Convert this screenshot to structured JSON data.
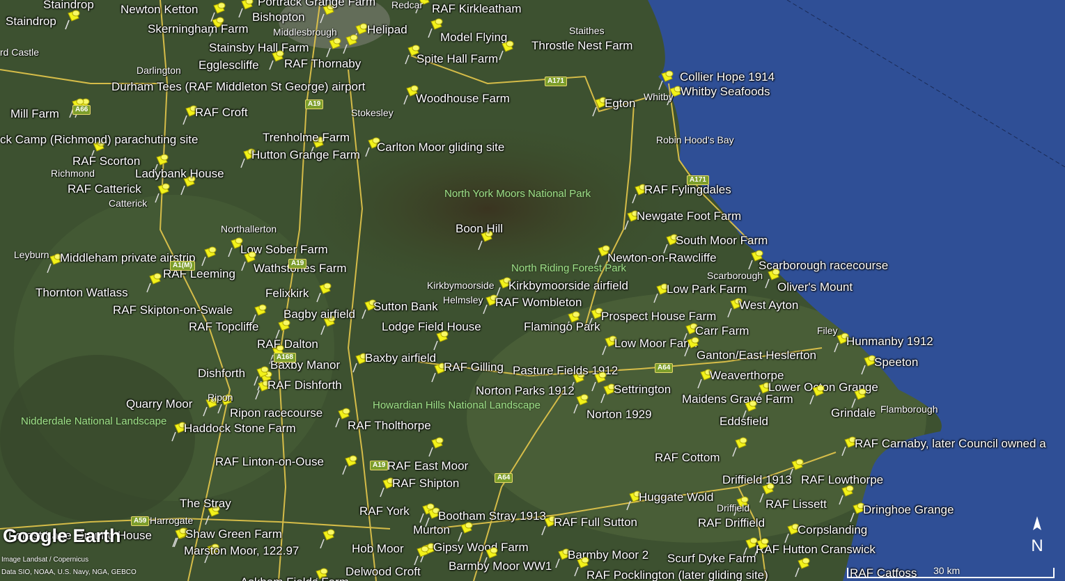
{
  "map": {
    "logo": "Google Earth",
    "credit_imagery": "Image Landsat / Copernicus",
    "credit_data": "Data SIO, NOAA, U.S. Navy, NGA, GEBCO",
    "scale_label": "30 km",
    "compass_label": "N",
    "colors": {
      "sea": "#2f4f96",
      "land": "#3b4f2c",
      "road": "#e6c84b",
      "pin": "#f2f21a"
    }
  },
  "placemarks": [
    {
      "id": "staindrop-a",
      "label": "Staindrop"
    },
    {
      "id": "staindrop-b",
      "label": "Staindrop"
    },
    {
      "id": "newton-ketton",
      "label": "Newton Ketton"
    },
    {
      "id": "bishopton",
      "label": "Bishopton"
    },
    {
      "id": "portrack",
      "label": "Portrack Grange Farm"
    },
    {
      "id": "raf-kirkleatham",
      "label": "RAF Kirkleatham"
    },
    {
      "id": "skerningham",
      "label": "Skerningham Farm"
    },
    {
      "id": "helipad",
      "label": "Helipad"
    },
    {
      "id": "model-flying",
      "label": "Model Flying"
    },
    {
      "id": "stainsby",
      "label": "Stainsby Hall Farm"
    },
    {
      "id": "throstle",
      "label": "Throstle Nest Farm"
    },
    {
      "id": "spite-hall",
      "label": "Spite Hall Farm"
    },
    {
      "id": "egglescliffe",
      "label": "Egglescliffe"
    },
    {
      "id": "raf-thornaby",
      "label": "RAF Thornaby"
    },
    {
      "id": "collier-hope",
      "label": "Collier Hope 1914"
    },
    {
      "id": "durham-tees",
      "label": "Durham Tees (RAF Middleton St George) airport"
    },
    {
      "id": "whitby-seafoods",
      "label": "Whitby Seafoods"
    },
    {
      "id": "woodhouse",
      "label": "Woodhouse Farm"
    },
    {
      "id": "egton",
      "label": "Egton"
    },
    {
      "id": "mill-farm",
      "label": "Mill Farm"
    },
    {
      "id": "raf-croft",
      "label": "RAF Croft"
    },
    {
      "id": "trenholme",
      "label": "Trenholme Farm"
    },
    {
      "id": "richmond-camp",
      "label": "ck Camp (Richmond) parachuting site"
    },
    {
      "id": "carlton-moor",
      "label": "Carlton Moor gliding site"
    },
    {
      "id": "hutton-grange",
      "label": "Hutton Grange Farm"
    },
    {
      "id": "raf-scorton",
      "label": "RAF Scorton"
    },
    {
      "id": "ladybank",
      "label": "Ladybank House"
    },
    {
      "id": "raf-catterick",
      "label": "RAF Catterick"
    },
    {
      "id": "raf-fylingdales",
      "label": "RAF Fylingdales"
    },
    {
      "id": "newgate-foot",
      "label": "Newgate Foot Farm"
    },
    {
      "id": "boon-hill",
      "label": "Boon Hill"
    },
    {
      "id": "south-moor",
      "label": "South Moor Farm"
    },
    {
      "id": "low-sober",
      "label": "Low Sober Farm"
    },
    {
      "id": "middleham",
      "label": "Middleham private airstrip"
    },
    {
      "id": "newton-rawcliffe",
      "label": "Newton-on-Rawcliffe"
    },
    {
      "id": "scarborough-race",
      "label": "Scarborough racecourse"
    },
    {
      "id": "wathstones",
      "label": "Wathstones Farm"
    },
    {
      "id": "raf-leeming",
      "label": "RAF Leeming"
    },
    {
      "id": "kirkbymoorside-af",
      "label": "Kirkbymoorside airfield"
    },
    {
      "id": "olivers-mount",
      "label": "Oliver's Mount"
    },
    {
      "id": "low-park",
      "label": "Low Park Farm"
    },
    {
      "id": "thornton-watlass",
      "label": "Thornton Watlass"
    },
    {
      "id": "felixkirk",
      "label": "Felixkirk"
    },
    {
      "id": "raf-wombleton",
      "label": "RAF Wombleton"
    },
    {
      "id": "west-ayton",
      "label": "West Ayton"
    },
    {
      "id": "sutton-bank",
      "label": "Sutton Bank"
    },
    {
      "id": "raf-skipton",
      "label": "RAF Skipton-on-Swale"
    },
    {
      "id": "bagby",
      "label": "Bagby airfield"
    },
    {
      "id": "prospect-house",
      "label": "Prospect House Farm"
    },
    {
      "id": "raf-topcliffe",
      "label": "RAF Topcliffe"
    },
    {
      "id": "lodge-field",
      "label": "Lodge Field House"
    },
    {
      "id": "flamingo-park",
      "label": "Flamingo Park"
    },
    {
      "id": "carr-farm",
      "label": "Carr Farm"
    },
    {
      "id": "hunmanby",
      "label": "Hunmanby 1912"
    },
    {
      "id": "raf-dalton",
      "label": "RAF Dalton"
    },
    {
      "id": "low-moor",
      "label": "Low Moor Farm"
    },
    {
      "id": "ganton",
      "label": "Ganton/East Heslerton"
    },
    {
      "id": "baxby-af",
      "label": "Baxby airfield"
    },
    {
      "id": "speeton",
      "label": "Speeton"
    },
    {
      "id": "baxby-manor",
      "label": "Baxby Manor"
    },
    {
      "id": "raf-gilling",
      "label": "RAF Gilling"
    },
    {
      "id": "pasture-fields",
      "label": "Pasture Fields 1912"
    },
    {
      "id": "dishforth",
      "label": "Dishforth"
    },
    {
      "id": "weaverthorpe",
      "label": "Weaverthorpe"
    },
    {
      "id": "raf-dishforth",
      "label": "RAF Dishforth"
    },
    {
      "id": "norton-parks",
      "label": "Norton Parks 1912"
    },
    {
      "id": "settrington",
      "label": "Settrington"
    },
    {
      "id": "lower-octon",
      "label": "Lower Octon Grange"
    },
    {
      "id": "maidens-grave",
      "label": "Maidens Grave Farm"
    },
    {
      "id": "quarry-moor",
      "label": "Quarry Moor"
    },
    {
      "id": "ripon-race",
      "label": "Ripon racecourse"
    },
    {
      "id": "grindale",
      "label": "Grindale"
    },
    {
      "id": "norton-1929",
      "label": "Norton 1929"
    },
    {
      "id": "eddsfield",
      "label": "Eddsfield"
    },
    {
      "id": "raf-tholthorpe",
      "label": "RAF Tholthorpe"
    },
    {
      "id": "haddock-stone",
      "label": "Haddock Stone Farm"
    },
    {
      "id": "raf-carnaby",
      "label": "RAF Carnaby, later Council owned a"
    },
    {
      "id": "raf-linton",
      "label": "RAF Linton-on-Ouse"
    },
    {
      "id": "raf-east-moor",
      "label": "RAF East Moor"
    },
    {
      "id": "raf-cottom",
      "label": "RAF Cottom"
    },
    {
      "id": "driffield-1913",
      "label": "Driffield 1913"
    },
    {
      "id": "raf-lowthorpe",
      "label": "RAF Lowthorpe"
    },
    {
      "id": "raf-shipton",
      "label": "RAF Shipton"
    },
    {
      "id": "huggate-wold",
      "label": "Huggate Wold"
    },
    {
      "id": "the-stray",
      "label": "The Stray"
    },
    {
      "id": "raf-lissett",
      "label": "RAF Lissett"
    },
    {
      "id": "raf-york",
      "label": "RAF York"
    },
    {
      "id": "dringhoe",
      "label": "Dringhoe Grange"
    },
    {
      "id": "bootham-stray",
      "label": "Bootham Stray 1913"
    },
    {
      "id": "raf-full-sutton",
      "label": "RAF Full Sutton"
    },
    {
      "id": "raf-driffield",
      "label": "RAF Driffield"
    },
    {
      "id": "murton",
      "label": "Murton"
    },
    {
      "id": "corpslanding",
      "label": "Corpslanding"
    },
    {
      "id": "forest-house",
      "label": "Forest Lane Ground House"
    },
    {
      "id": "shaw-green",
      "label": "Shaw Green Farm"
    },
    {
      "id": "gipsy-wood",
      "label": "Gipsy Wood Farm"
    },
    {
      "id": "hob-moor",
      "label": "Hob Moor"
    },
    {
      "id": "raf-hutton-cranswick",
      "label": "RAF Hutton Cranswick"
    },
    {
      "id": "marston-moor",
      "label": "Marston Moor, 122.97"
    },
    {
      "id": "barmby-moor-2",
      "label": "Barmby Moor 2"
    },
    {
      "id": "scurf-dyke",
      "label": "Scurf Dyke Farm"
    },
    {
      "id": "barmby-moor-ww1",
      "label": "Barmby Moor WW1"
    },
    {
      "id": "delwood-croft",
      "label": "Delwood Croft"
    },
    {
      "id": "raf-catfoss",
      "label": "RAF Catfoss"
    },
    {
      "id": "raf-pocklington",
      "label": "RAF Pocklington (later gliding site)"
    },
    {
      "id": "askham-fields",
      "label": "Askham Fields Farm"
    }
  ],
  "places": [
    {
      "id": "redcar",
      "label": "Redcar"
    },
    {
      "id": "middlesbrough",
      "label": "Middlesbrough"
    },
    {
      "id": "staithes",
      "label": "Staithes"
    },
    {
      "id": "castle",
      "label": "rd Castle"
    },
    {
      "id": "darlington",
      "label": "Darlington"
    },
    {
      "id": "whitby",
      "label": "Whitby"
    },
    {
      "id": "stokesley",
      "label": "Stokesley"
    },
    {
      "id": "robin-hoods-bay",
      "label": "Robin Hood's Bay"
    },
    {
      "id": "richmond",
      "label": "Richmond"
    },
    {
      "id": "catterick",
      "label": "Catterick"
    },
    {
      "id": "northallerton",
      "label": "Northallerton"
    },
    {
      "id": "leyburn",
      "label": "Leyburn"
    },
    {
      "id": "scarborough",
      "label": "Scarborough"
    },
    {
      "id": "kirkbymoorside",
      "label": "Kirkbymoorside"
    },
    {
      "id": "helmsley",
      "label": "Helmsley"
    },
    {
      "id": "filey",
      "label": "Filey"
    },
    {
      "id": "ripon",
      "label": "Ripon"
    },
    {
      "id": "flamborough",
      "label": "Flamborough"
    },
    {
      "id": "harrogate",
      "label": "Harrogate"
    },
    {
      "id": "driffield",
      "label": "Driffield"
    }
  ],
  "parks": [
    {
      "id": "nym",
      "label": "North York Moors National Park"
    },
    {
      "id": "nrfp",
      "label": "North Riding Forest Park"
    },
    {
      "id": "howardian",
      "label": "Howardian Hills National Landscape"
    },
    {
      "id": "nidderdale",
      "label": "Nidderdale National Landscape"
    }
  ],
  "roads": [
    "A19",
    "A171",
    "A171",
    "A64",
    "A64",
    "A19",
    "A59",
    "A168",
    "A1(M)",
    "A19",
    "A66"
  ]
}
